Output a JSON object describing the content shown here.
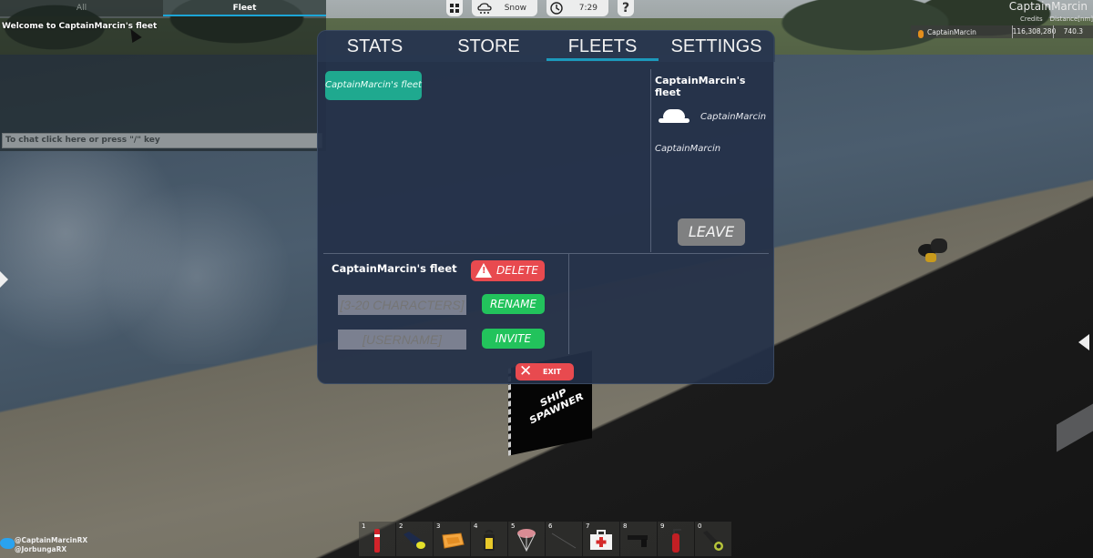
{
  "chat": {
    "tabs": [
      {
        "label": "All",
        "active": false
      },
      {
        "label": "Fleet",
        "active": true
      }
    ],
    "messages": [
      "Welcome to CaptainMarcin's fleet"
    ],
    "input_placeholder": "To chat click here or press \"/\" key"
  },
  "topbar": {
    "menu_icon": "grid-icon",
    "weather": {
      "icon": "snow-cloud-icon",
      "label": "Snow"
    },
    "time": {
      "icon": "clock-icon",
      "label": "7:29"
    },
    "help_label": "?"
  },
  "leaderboard": {
    "title": "CaptainMarcin",
    "columns": [
      "Credits",
      "Distance[nm]"
    ],
    "rows": [
      {
        "name": "CaptainMarcin",
        "credits": "116,308,280",
        "distance": "740.3"
      }
    ]
  },
  "panel": {
    "tabs": [
      {
        "label": "STATS",
        "active": false
      },
      {
        "label": "STORE",
        "active": false
      },
      {
        "label": "FLEETS",
        "active": true
      },
      {
        "label": "SETTINGS",
        "active": false
      }
    ],
    "accent_color": "#1c99bb",
    "fleets": [
      "CaptainMarcin's fleet"
    ],
    "info": {
      "title": "CaptainMarcin's fleet",
      "captain": "CaptainMarcin",
      "members": [
        "CaptainMarcin"
      ],
      "leave_label": "LEAVE"
    },
    "manage": {
      "title": "CaptainMarcin's fleet",
      "delete_label": "DELETE",
      "rename_placeholder": "[3-20 CHARACTERS]",
      "rename_label": "RENAME",
      "invite_placeholder": "[USERNAME]",
      "invite_label": "INVITE"
    },
    "exit_label": "EXIT"
  },
  "world": {
    "ship_spawner_label": "SHIP SPAWNER"
  },
  "hotbar": {
    "slots": [
      {
        "key": "1",
        "item": "flare-icon"
      },
      {
        "key": "2",
        "item": "flashlight-icon"
      },
      {
        "key": "3",
        "item": "life-raft-icon"
      },
      {
        "key": "4",
        "item": "lantern-icon"
      },
      {
        "key": "5",
        "item": "parachute-icon"
      },
      {
        "key": "6",
        "item": "fishing-rod-icon"
      },
      {
        "key": "7",
        "item": "first-aid-kit-icon"
      },
      {
        "key": "8",
        "item": "pistol-icon"
      },
      {
        "key": "9",
        "item": "fire-extinguisher-icon"
      },
      {
        "key": "0",
        "item": "spyglass-icon"
      }
    ]
  },
  "social": {
    "handles": [
      "@CaptainMarcinRX",
      "@JorbungaRX"
    ]
  }
}
